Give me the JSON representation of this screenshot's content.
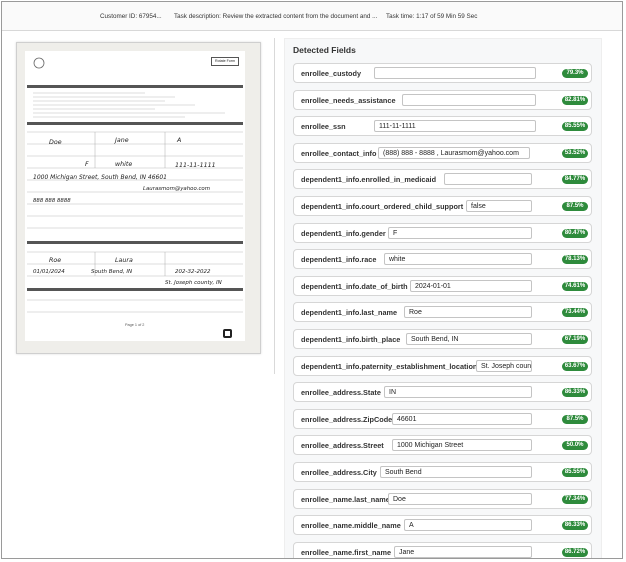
{
  "topbar": {
    "customer_id": "Customer ID: 67954...",
    "task_description": "Task description: Review the extracted content from the document and ...",
    "task_time": "Task time: 1:17 of 59 Min 59 Sec"
  },
  "document": {
    "reset_label": "Rotate Form",
    "form_title": "INDIANA CHILD SUPPORT SERVICES ENROLLMENT",
    "sections": [
      "NOTICE TO APPLICANT",
      "ENROLLEE INFORMATION",
      "DEPENDENT (1) INFORMATION",
      "DEPENDENT (2) INFORMATION"
    ],
    "handwriting": {
      "last_name": "Doe",
      "first_name": "Jane",
      "middle": "A",
      "ssn": "111-11-1111",
      "gender": "F",
      "race": "white",
      "street": "1000 Michigan Street, South Bend, IN 46601",
      "email": "Laurasmom@yahoo.com",
      "phone": "888 888 8888",
      "dep_last": "Roe",
      "dep_first": "Laura",
      "dep_dob": "01/01/2024",
      "dep_place": "South Bend, IN",
      "dep_phone": "202-32-2022",
      "dep_county": "St. Joseph county, IN"
    },
    "page_number": "Page 1 of 2",
    "app_label": "Scanner App"
  },
  "panel": {
    "title": "Detected Fields",
    "fields": [
      {
        "label": "enrollee_custody",
        "value": "",
        "score": "79.3%"
      },
      {
        "label": "enrollee_needs_assistance",
        "value": "",
        "score": "82.81%"
      },
      {
        "label": "enrollee_ssn",
        "value": "111-11-1111",
        "score": "85.55%"
      },
      {
        "label": "enrollee_contact_info",
        "value": "(888) 888 - 8888 , Laurasmom@yahoo.com",
        "score": "53.52%"
      },
      {
        "label": "dependent1_info.enrolled_in_medicaid",
        "value": "",
        "score": "84.77%"
      },
      {
        "label": "dependent1_info.court_ordered_child_support",
        "value": "false",
        "score": "87.5%"
      },
      {
        "label": "dependent1_info.gender",
        "value": "F",
        "score": "80.47%"
      },
      {
        "label": "dependent1_info.race",
        "value": "white",
        "score": "78.13%"
      },
      {
        "label": "dependent1_info.date_of_birth",
        "value": "2024-01-01",
        "score": "74.61%"
      },
      {
        "label": "dependent1_info.last_name",
        "value": "Roe",
        "score": "73.44%"
      },
      {
        "label": "dependent1_info.birth_place",
        "value": "South Bend, IN",
        "score": "67.19%"
      },
      {
        "label": "dependent1_info.paternity_establishment_location",
        "value": "St. Joseph county, IN",
        "score": "63.67%"
      },
      {
        "label": "enrollee_address.State",
        "value": "IN",
        "score": "86.33%"
      },
      {
        "label": "enrollee_address.ZipCode",
        "value": "46601",
        "score": "87.5%"
      },
      {
        "label": "enrollee_address.Street",
        "value": "1000 Michigan Street",
        "score": "50.0%"
      },
      {
        "label": "enrollee_address.City",
        "value": "South Bend",
        "score": "85.55%"
      },
      {
        "label": "enrollee_name.last_name",
        "value": "Doe",
        "score": "77.34%"
      },
      {
        "label": "enrollee_name.middle_name",
        "value": "A",
        "score": "86.33%"
      },
      {
        "label": "enrollee_name.first_name",
        "value": "Jane",
        "score": "86.72%"
      }
    ]
  },
  "colors": {
    "badge": "#2e8b3c",
    "row_border": "#d6d6d6"
  }
}
